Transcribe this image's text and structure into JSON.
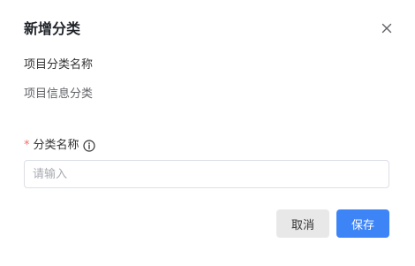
{
  "dialog": {
    "title": "新增分类",
    "close_icon": "close-icon"
  },
  "section": {
    "label": "项目分类名称",
    "value": "项目信息分类"
  },
  "form": {
    "required_mark": "*",
    "field_label": "分类名称",
    "info_icon": "info-circle-icon",
    "input_value": "",
    "input_placeholder": "请输入"
  },
  "footer": {
    "cancel_label": "取消",
    "save_label": "保存"
  },
  "colors": {
    "primary": "#3d84f7",
    "required": "#f56c6c",
    "cancel_bg": "#e8e8e8",
    "border": "#dcdfe6"
  }
}
